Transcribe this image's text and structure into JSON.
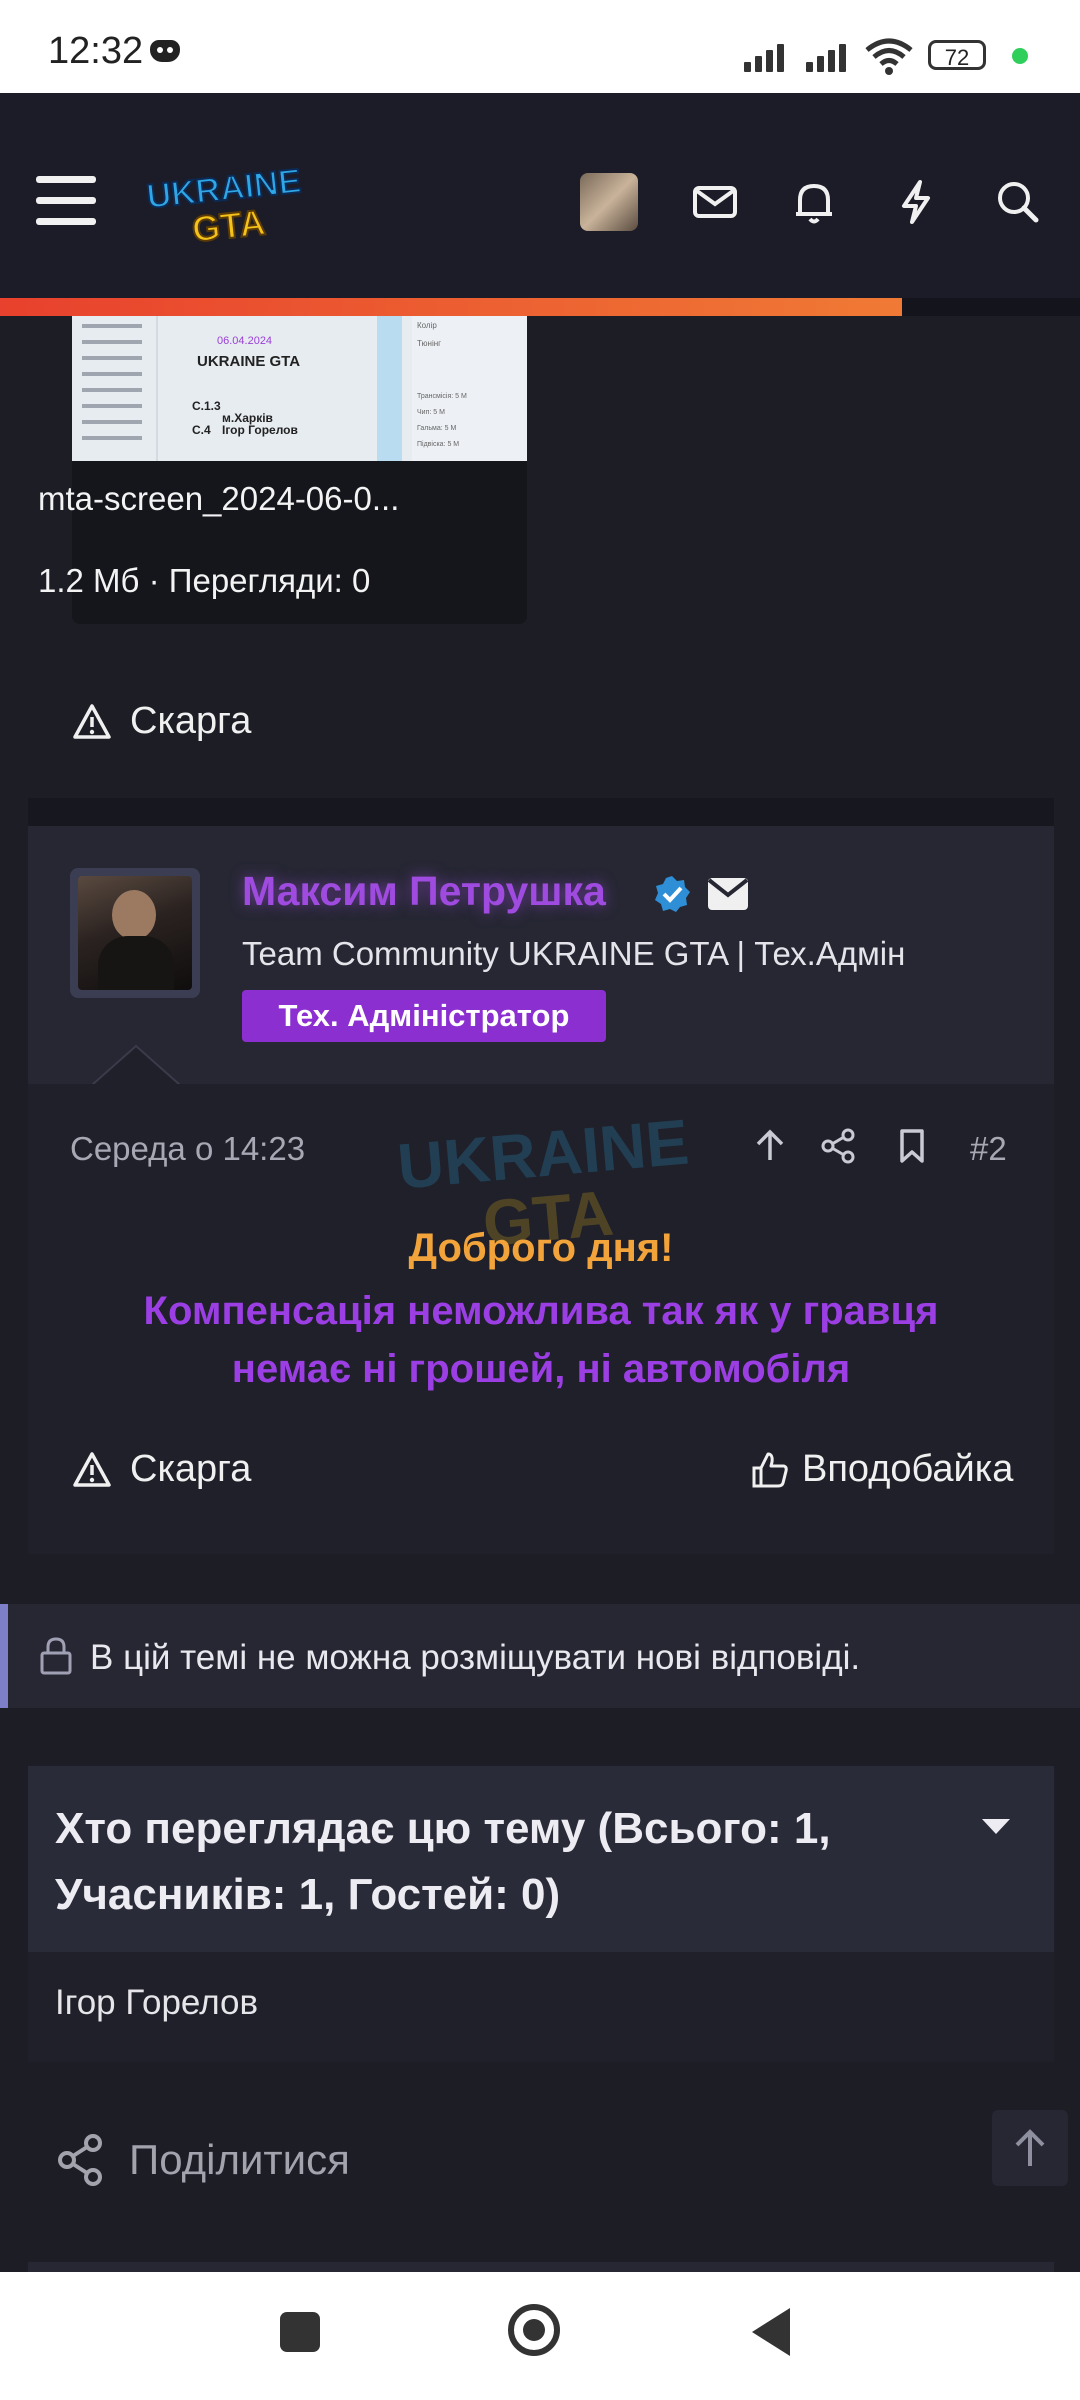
{
  "status_bar": {
    "time": "12:32",
    "battery": "72"
  },
  "header": {
    "logo_line1": "UKRAINE",
    "logo_line2": "GTA",
    "progress": 0.835
  },
  "attachment": {
    "thumbnail": {
      "plate_line": "UKRAINE GTA",
      "date": "06.04.2024",
      "code1": "C.1.3",
      "city": "м.Харків",
      "code2": "C.4",
      "owner": "Ігор Горелов",
      "side_labels": [
        "Колір",
        "Тюнінг",
        "Трансмісія: 5 М",
        "Чип: 5 М",
        "Гальма: 5 М",
        "Підвіска: 5 М"
      ]
    },
    "filename": "mta-screen_2024-06-0...",
    "meta": "1.2 Мб · Перегляди: 0"
  },
  "post1": {
    "report_label": "Скарга"
  },
  "post2": {
    "username": "Максим Петрушка",
    "user_title": "Team Community UKRAINE GTA | Тех.Адмін",
    "role_badge": "Тех. Адміністратор",
    "date": "Середа о 14:23",
    "post_number": "#2",
    "greeting": "Доброго дня!",
    "message_line1": "Компенсація неможлива так як у гравця",
    "message_line2": "немає ні грошей, ні автомобіля",
    "report_label": "Скарга",
    "like_label": "Вподобайка"
  },
  "locked_notice": "В цій темі не можна розміщувати нові відповіді.",
  "viewers": {
    "title": "Хто переглядає цю тему (Всього: 1, Учасників: 1, Гостей: 0)",
    "members": [
      "Ігор Горелов"
    ]
  },
  "share_label": "Поділитися",
  "colors": {
    "background": "#1c1d25",
    "accent_orange": "#f2a33a",
    "accent_purple": "#9b3fe4",
    "badge": "#8b2fd0",
    "progress": "#e8412d"
  }
}
